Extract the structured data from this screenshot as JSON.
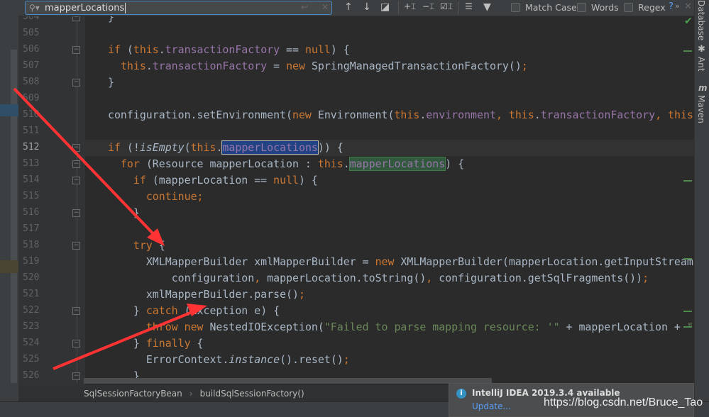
{
  "search": {
    "value": "mapperLocations",
    "match_case": "Match Case",
    "words": "Words",
    "regex": "Regex",
    "help": "?",
    "more": "»"
  },
  "right_tools": [
    "Database",
    "Ant",
    "Maven"
  ],
  "current_line": 512,
  "lines": [
    {
      "n": 504,
      "indent": 0,
      "t": [
        [
          "p",
          "}"
        ]
      ]
    },
    {
      "n": 505,
      "indent": 0,
      "t": []
    },
    {
      "n": 506,
      "indent": 0,
      "t": [
        [
          "k",
          "if "
        ],
        [
          "p",
          "("
        ],
        [
          "k",
          "this"
        ],
        [
          "p",
          "."
        ],
        [
          "f",
          "transactionFactory"
        ],
        [
          "p",
          " == "
        ],
        [
          "k",
          "null"
        ],
        [
          "p",
          ") {"
        ]
      ]
    },
    {
      "n": 507,
      "indent": 2,
      "t": [
        [
          "k",
          "this"
        ],
        [
          "p",
          "."
        ],
        [
          "f",
          "transactionFactory"
        ],
        [
          "p",
          " = "
        ],
        [
          "k",
          "new "
        ],
        [
          "p",
          "SpringManagedTransactionFactory()"
        ],
        [
          "k",
          ";"
        ]
      ]
    },
    {
      "n": 508,
      "indent": 0,
      "t": [
        [
          "p",
          "}"
        ]
      ]
    },
    {
      "n": 509,
      "indent": 0,
      "t": []
    },
    {
      "n": 510,
      "indent": 0,
      "t": [
        [
          "p",
          "configuration.setEnvironment("
        ],
        [
          "k",
          "new "
        ],
        [
          "p",
          "Environment("
        ],
        [
          "k",
          "this"
        ],
        [
          "p",
          "."
        ],
        [
          "f",
          "environment"
        ],
        [
          "k",
          ", "
        ],
        [
          "k",
          "this"
        ],
        [
          "p",
          "."
        ],
        [
          "f",
          "transactionFactory"
        ],
        [
          "k",
          ", "
        ],
        [
          "k",
          "this"
        ],
        [
          "p",
          "."
        ]
      ]
    },
    {
      "n": 511,
      "indent": 0,
      "t": []
    },
    {
      "n": 512,
      "indent": 0,
      "t": [
        [
          "k",
          "if "
        ],
        [
          "p",
          "(!"
        ],
        [
          "i",
          "isEmpty"
        ],
        [
          "p",
          "("
        ],
        [
          "k",
          "this"
        ],
        [
          "p",
          "."
        ],
        [
          "hl1",
          "mapperLocations"
        ],
        [
          "p",
          ")) {"
        ]
      ]
    },
    {
      "n": 513,
      "indent": 2,
      "t": [
        [
          "k",
          "for "
        ],
        [
          "p",
          "(Resource mapperLocation : "
        ],
        [
          "k",
          "this"
        ],
        [
          "p",
          "."
        ],
        [
          "hl2",
          "mapperLocations"
        ],
        [
          "p",
          ") {"
        ]
      ]
    },
    {
      "n": 514,
      "indent": 4,
      "t": [
        [
          "k",
          "if "
        ],
        [
          "p",
          "(mapperLocation == "
        ],
        [
          "k",
          "null"
        ],
        [
          "p",
          ") {"
        ]
      ]
    },
    {
      "n": 515,
      "indent": 6,
      "t": [
        [
          "k",
          "continue;"
        ]
      ]
    },
    {
      "n": 516,
      "indent": 4,
      "t": [
        [
          "p",
          "}"
        ]
      ]
    },
    {
      "n": 517,
      "indent": 0,
      "t": []
    },
    {
      "n": 518,
      "indent": 4,
      "t": [
        [
          "k",
          "try "
        ],
        [
          "p",
          "{"
        ]
      ]
    },
    {
      "n": 519,
      "indent": 6,
      "t": [
        [
          "p",
          "XMLMapperBuilder xmlMapperBuilder = "
        ],
        [
          "k",
          "new "
        ],
        [
          "p",
          "XMLMapperBuilder(mapperLocation.getInputStream"
        ]
      ]
    },
    {
      "n": 520,
      "indent": 10,
      "t": [
        [
          "p",
          "configuration"
        ],
        [
          "k",
          ", "
        ],
        [
          "p",
          "mapperLocation.toString()"
        ],
        [
          "k",
          ", "
        ],
        [
          "p",
          "configuration.getSqlFragments())"
        ],
        [
          "k",
          ";"
        ]
      ]
    },
    {
      "n": 521,
      "indent": 6,
      "t": [
        [
          "p",
          "xmlMapperBuilder.parse()"
        ],
        [
          "k",
          ";"
        ]
      ]
    },
    {
      "n": 522,
      "indent": 4,
      "t": [
        [
          "p",
          "} "
        ],
        [
          "k",
          "catch "
        ],
        [
          "p",
          "(Exception e) {"
        ]
      ]
    },
    {
      "n": 523,
      "indent": 6,
      "t": [
        [
          "k",
          "throw new "
        ],
        [
          "p",
          "NestedIOException("
        ],
        [
          "s",
          "\"Failed to parse mapping resource: '\""
        ],
        [
          "p",
          " + mapperLocation + "
        ],
        [
          "s",
          "\""
        ]
      ]
    },
    {
      "n": 524,
      "indent": 4,
      "t": [
        [
          "p",
          "} "
        ],
        [
          "k",
          "finally "
        ],
        [
          "p",
          "{"
        ]
      ]
    },
    {
      "n": 525,
      "indent": 6,
      "t": [
        [
          "p",
          "ErrorContext."
        ],
        [
          "i",
          "instance"
        ],
        [
          "p",
          "().reset()"
        ],
        [
          "k",
          ";"
        ]
      ]
    },
    {
      "n": 526,
      "indent": 4,
      "t": [
        [
          "p",
          "}"
        ]
      ]
    }
  ],
  "breadcrumb": [
    "SqlSessionFactoryBean",
    "buildSqlSessionFactory()"
  ],
  "notification": {
    "title": "IntelliJ IDEA 2019.3.4 available",
    "action": "Update..."
  },
  "watermark": "https://blog.csdn.net/Bruce_Tao",
  "colors": {
    "keyword": "#cc7832",
    "field": "#9876aa",
    "string": "#6a8759",
    "text": "#a9b7c6",
    "background": "#2b2b2b",
    "annotation_arrow": "#ff3333"
  }
}
